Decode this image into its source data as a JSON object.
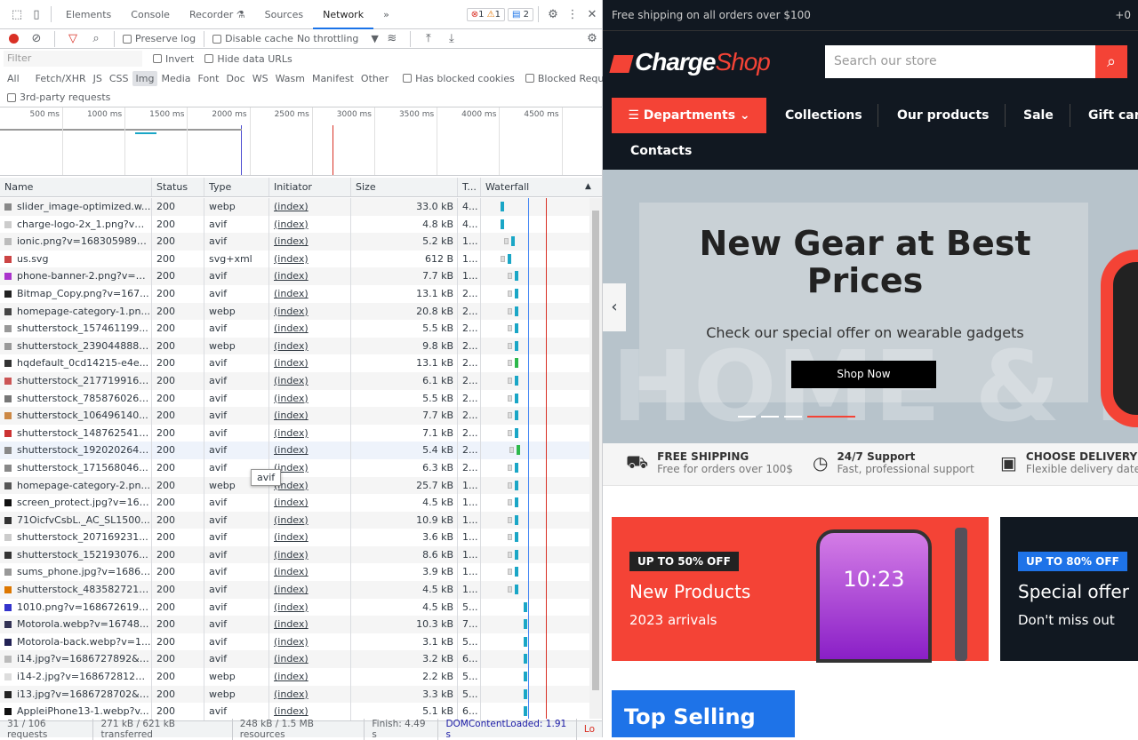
{
  "devtools": {
    "tabs": [
      "Elements",
      "Console",
      "Recorder",
      "Sources",
      "Network"
    ],
    "active_tab": "Network",
    "counts": {
      "errors": "1",
      "warnings": "1",
      "messages": "2"
    },
    "toolbar": {
      "preserve_log": "Preserve log",
      "disable_cache": "Disable cache",
      "throttling": "No throttling"
    },
    "filter": {
      "placeholder": "Filter",
      "invert": "Invert",
      "hide_data_urls": "Hide data URLs"
    },
    "types": [
      "All",
      "Fetch/XHR",
      "JS",
      "CSS",
      "Img",
      "Media",
      "Font",
      "Doc",
      "WS",
      "Wasm",
      "Manifest",
      "Other"
    ],
    "active_type": "Img",
    "has_blocked_cookies": "Has blocked cookies",
    "blocked_requests": "Blocked Requests",
    "third_party": "3rd-party requests",
    "overview_ticks": [
      "500 ms",
      "1000 ms",
      "1500 ms",
      "2000 ms",
      "2500 ms",
      "3000 ms",
      "3500 ms",
      "4000 ms",
      "4500 ms",
      "5("
    ],
    "columns": [
      "Name",
      "Status",
      "Type",
      "Initiator",
      "Size",
      "T...",
      "Waterfall"
    ],
    "rows": [
      [
        "slider_image-optimized.w...",
        "200",
        "webp",
        "(index)",
        "33.0 kB",
        "4..."
      ],
      [
        "charge-logo-2x_1.png?v=...",
        "200",
        "avif",
        "(index)",
        "4.8 kB",
        "4..."
      ],
      [
        "ionic.png?v=1683059895...",
        "200",
        "avif",
        "(index)",
        "5.2 kB",
        "1..."
      ],
      [
        "us.svg",
        "200",
        "svg+xml",
        "(index)",
        "612 B",
        "1..."
      ],
      [
        "phone-banner-2.png?v=1...",
        "200",
        "avif",
        "(index)",
        "7.7 kB",
        "1..."
      ],
      [
        "Bitmap_Copy.png?v=167...",
        "200",
        "avif",
        "(index)",
        "13.1 kB",
        "2..."
      ],
      [
        "homepage-category-1.pn...",
        "200",
        "webp",
        "(index)",
        "20.8 kB",
        "2..."
      ],
      [
        "shutterstock_157461199...",
        "200",
        "avif",
        "(index)",
        "5.5 kB",
        "2..."
      ],
      [
        "shutterstock_239044888....",
        "200",
        "webp",
        "(index)",
        "9.8 kB",
        "2..."
      ],
      [
        "hqdefault_0cd14215-e4e...",
        "200",
        "avif",
        "(index)",
        "13.1 kB",
        "2..."
      ],
      [
        "shutterstock_217719916....",
        "200",
        "avif",
        "(index)",
        "6.1 kB",
        "2..."
      ],
      [
        "shutterstock_785876026....",
        "200",
        "avif",
        "(index)",
        "5.5 kB",
        "2..."
      ],
      [
        "shutterstock_106496140...",
        "200",
        "avif",
        "(index)",
        "7.7 kB",
        "2..."
      ],
      [
        "shutterstock_148762541....",
        "200",
        "avif",
        "(index)",
        "7.1 kB",
        "2..."
      ],
      [
        "shutterstock_192020264....",
        "200",
        "avif",
        "(index)",
        "5.4 kB",
        "2..."
      ],
      [
        "shutterstock_171568046...",
        "200",
        "avif",
        "(index)",
        "6.3 kB",
        "2..."
      ],
      [
        "homepage-category-2.pn...",
        "200",
        "webp",
        "(index)",
        "25.7 kB",
        "1..."
      ],
      [
        "screen_protect.jpg?v=168...",
        "200",
        "avif",
        "(index)",
        "4.5 kB",
        "1..."
      ],
      [
        "71OicfvCsbL._AC_SL1500...",
        "200",
        "avif",
        "(index)",
        "10.9 kB",
        "1..."
      ],
      [
        "shutterstock_207169231...",
        "200",
        "avif",
        "(index)",
        "3.6 kB",
        "1..."
      ],
      [
        "shutterstock_152193076...",
        "200",
        "avif",
        "(index)",
        "8.6 kB",
        "1..."
      ],
      [
        "sums_phone.jpg?v=16862...",
        "200",
        "avif",
        "(index)",
        "3.9 kB",
        "1..."
      ],
      [
        "shutterstock_483582721....",
        "200",
        "avif",
        "(index)",
        "4.5 kB",
        "1..."
      ],
      [
        "1010.png?v=1686726198...",
        "200",
        "avif",
        "(index)",
        "4.5 kB",
        "5..."
      ],
      [
        "Motorola.webp?v=16748...",
        "200",
        "avif",
        "(index)",
        "10.3 kB",
        "7..."
      ],
      [
        "Motorola-back.webp?v=1...",
        "200",
        "avif",
        "(index)",
        "3.1 kB",
        "5..."
      ],
      [
        "i14.jpg?v=1686727892&w...",
        "200",
        "avif",
        "(index)",
        "3.2 kB",
        "6..."
      ],
      [
        "i14-2.jpg?v=1686728123&...",
        "200",
        "webp",
        "(index)",
        "2.2 kB",
        "5..."
      ],
      [
        "i13.jpg?v=1686728702&w...",
        "200",
        "webp",
        "(index)",
        "3.3 kB",
        "5..."
      ],
      [
        "AppleiPhone13-1.webp?v...",
        "200",
        "avif",
        "(index)",
        "5.1 kB",
        "6..."
      ]
    ],
    "tooltip": "avif",
    "footer": [
      "31 / 106 requests",
      "271 kB / 621 kB transferred",
      "248 kB / 1.5 MB resources",
      "Finish: 4.49 s",
      "DOMContentLoaded: 1.91 s",
      "Lo"
    ]
  },
  "page": {
    "topbar": {
      "left": "Free shipping on all orders over $100",
      "right": "+0"
    },
    "logo": "ChargeShop",
    "search_placeholder": "Search our store",
    "nav": {
      "departments": "Departments",
      "items": [
        "Collections",
        "Our products",
        "Sale",
        "Gift car"
      ],
      "contacts": "Contacts"
    },
    "hero": {
      "title": "New Gear at Best Prices",
      "subtitle": "Check our special offer on wearable gadgets",
      "button": "Shop Now",
      "watermark": "HOME & F",
      "slide_index": 4,
      "slide_count": 4
    },
    "features": [
      {
        "title": "FREE SHIPPING",
        "text": "Free for orders over 100$"
      },
      {
        "title": "24/7 Support",
        "text": "Fast, professional support"
      },
      {
        "title": "CHOOSE DELIVERY DA",
        "text": "Flexible delivery dates"
      }
    ],
    "promos": [
      {
        "tag": "UP TO 50% OFF",
        "title": "New Products",
        "sub": "2023 arrivals",
        "phone_time": "10:23"
      },
      {
        "tag": "UP TO 80% OFF",
        "title": "Special offer",
        "sub": "Don't miss out"
      }
    ],
    "top_selling": "Top Selling",
    "colors": {
      "accent": "#f44336",
      "dark": "#111821",
      "blue": "#1e73e8"
    }
  }
}
